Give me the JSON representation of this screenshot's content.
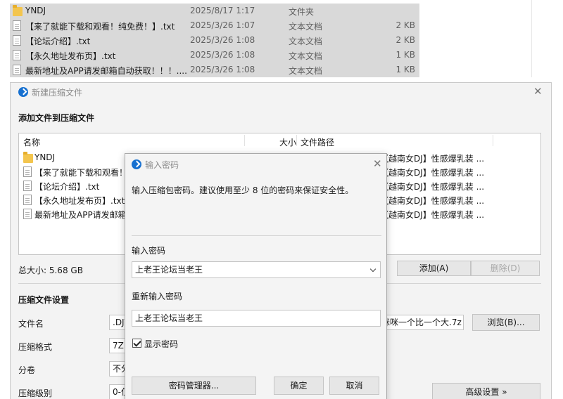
{
  "explorer": {
    "rows": [
      {
        "name": "YNDJ",
        "date": "2025/8/17 1:17",
        "type": "文件夹",
        "size": "",
        "icon": "folder-icon"
      },
      {
        "name": "【来了就能下载和观看！纯免费！】.txt",
        "date": "2025/3/26 1:07",
        "type": "文本文档",
        "size": "2 KB",
        "icon": "text-file-icon"
      },
      {
        "name": "【论坛介绍】.txt",
        "date": "2025/3/26 1:08",
        "type": "文本文档",
        "size": "2 KB",
        "icon": "text-file-icon"
      },
      {
        "name": "【永久地址发布页】.txt",
        "date": "2025/3/26 1:08",
        "type": "文本文档",
        "size": "1 KB",
        "icon": "text-file-icon"
      },
      {
        "name": "最新地址及APP请发邮箱自动获取！！！....",
        "date": "2025/3/26 1:08",
        "type": "文本文档",
        "size": "1 KB",
        "icon": "text-file-icon"
      }
    ]
  },
  "main_dialog": {
    "title": "新建压缩文件",
    "section_add": "添加文件到压缩文件",
    "columns": {
      "name": "名称",
      "size": "大小",
      "path": "文件路径"
    },
    "files": [
      {
        "name": "YNDJ",
        "icon": "folder-icon"
      },
      {
        "name": "【来了就能下载和观看！",
        "icon": "text-file-icon"
      },
      {
        "name": "【论坛介绍】.txt",
        "icon": "text-file-icon"
      },
      {
        "name": "【永久地址发布页】.txt",
        "icon": "text-file-icon"
      },
      {
        "name": "最新地址及APP请发邮箱",
        "icon": "text-file-icon"
      }
    ],
    "paths": [
      "【越南女DJ】性感爆乳装 ...",
      "【越南女DJ】性感爆乳装 ...",
      "【越南女DJ】性感爆乳装 ...",
      "【越南女DJ】性感爆乳装 ...",
      "【越南女DJ】性感爆乳装 ..."
    ],
    "total_size": "总大小: 5.68 GB",
    "add_button": "添加(A)",
    "delete_button": "删除(D)",
    "section_settings": "压缩文件设置",
    "filename_label": "文件名",
    "filename_value_left": ".DJ\\",
    "filename_value_right": "眯咪一个比一个大.7z",
    "browse_button": "浏览(B)...",
    "format_label": "压缩格式",
    "format_value": "7Z",
    "split_label": "分卷",
    "split_value": "不分",
    "level_label": "压缩级别",
    "level_value": "0-仅",
    "advanced_button": "高级设置 »"
  },
  "password_dialog": {
    "title": "输入密码",
    "description": "输入压缩包密码。建议使用至少 8 位的密码来保证安全性。",
    "password_label": "输入密码",
    "password_value": "上老王论坛当老王",
    "reenter_label": "重新输入密码",
    "reenter_value": "上老王论坛当老王",
    "show_password_label": "显示密码",
    "show_password_checked": true,
    "manager_button": "密码管理器...",
    "ok_button": "确定",
    "cancel_button": "取消"
  },
  "colors": {
    "row_highlight": "#d9d9d9",
    "dialog_bg": "#f3f3f3",
    "accent": "#1670d0"
  }
}
